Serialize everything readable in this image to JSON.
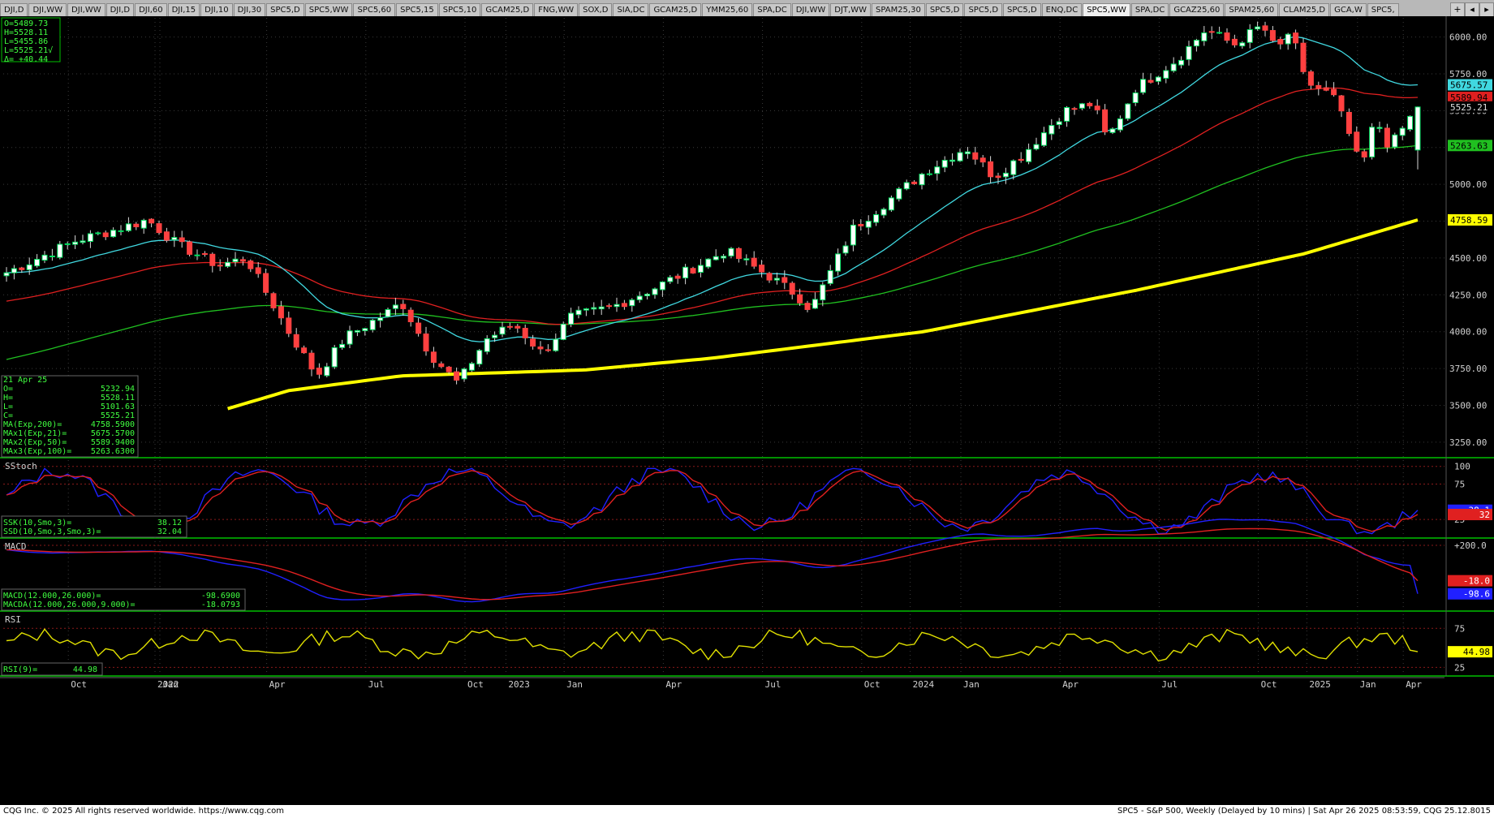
{
  "tabs": [
    "DJI,D",
    "DJI,WW",
    "DJI,WW",
    "DJI,D",
    "DJI,60",
    "DJI,15",
    "DJI,10",
    "DJI,30",
    "SPC5,D",
    "SPC5,WW",
    "SPC5,60",
    "SPC5,15",
    "SPC5,10",
    "GCAM25,D",
    "FNG,WW",
    "SOX,D",
    "SIA,DC",
    "GCAM25,D",
    "YMM25,60",
    "SPA,DC",
    "DJI,WW",
    "DJT,WW",
    "SPAM25,30",
    "SPC5,D",
    "SPC5,D",
    "SPC5,D",
    "ENQ,DC",
    "SPC5,WW",
    "SPA,DC",
    "GCAZ25,60",
    "SPAM25,60",
    "CLAM25,D",
    "GCA,W",
    "SPC5,"
  ],
  "active_tab": 27,
  "tab_controls": [
    "+",
    "◂",
    "▸"
  ],
  "footer": {
    "left": "CQG Inc. © 2025 All rights reserved worldwide. https://www.cqg.com",
    "right": "SPC5 - S&P 500, Weekly (Delayed by 10 mins) | Sat Apr 26 2025 08:53:59, CQG 25.12.8015"
  },
  "colors": {
    "background": "#000000",
    "grid": "#3a3a3a",
    "up_candle": "#00e060",
    "down_candle": "#ff4040",
    "wick": "#d8d8d8",
    "ma200": "#ffff00",
    "ma21": "#40d8e0",
    "ma50": "#e02020",
    "ma100": "#20c020",
    "ssk": "#2020ff",
    "ssd": "#e02020",
    "macd": "#2020ff",
    "macda": "#e02020",
    "rsi": "#e0e000",
    "panel_border": "#00c000",
    "text_green": "#40ff40"
  },
  "chart_data": [
    {
      "type": "candlestick",
      "title": "",
      "price_axis_ticks": [
        "6000.00",
        "5750.00",
        "5500.00",
        "5250.00",
        "5000.00",
        "4750.00",
        "4500.00",
        "4250.00",
        "4000.00",
        "3750.00",
        "3500.00",
        "3250.00"
      ],
      "ylim": [
        3150,
        6130
      ],
      "x_axis_labels": [
        "Oct",
        "2022",
        "Jan",
        "Apr",
        "Jul",
        "Oct",
        "2023",
        "Jan",
        "Apr",
        "Jul",
        "Oct",
        "2024",
        "Jan",
        "Apr",
        "Jul",
        "Oct",
        "2025",
        "Jan",
        "Apr"
      ],
      "price_tags": [
        {
          "value": 5675.57,
          "label": "5675.57",
          "color": "#40d8e0"
        },
        {
          "value": 5589.94,
          "label": "5589.94",
          "color": "#e02020"
        },
        {
          "value": 5525.21,
          "label": "5525.21",
          "color": "#000000"
        },
        {
          "value": 5263.63,
          "label": "5263.63",
          "color": "#20c020"
        },
        {
          "value": 4758.59,
          "label": "4758.59",
          "color": "#ffff00"
        }
      ],
      "ohlc_box": [
        "O=5489.73",
        "H=5528.11",
        "L=5455.86",
        "L=5525.21√",
        "Δ= +40.44"
      ],
      "data_window": [
        {
          "label": "21 Apr 25",
          "value": ""
        },
        {
          "label": "O=",
          "value": "5232.94"
        },
        {
          "label": "H=",
          "value": "5528.11"
        },
        {
          "label": "L=",
          "value": "5101.63"
        },
        {
          "label": "C=",
          "value": "5525.21"
        },
        {
          "label": "MA(Exp,200)=",
          "value": "4758.5900"
        },
        {
          "label": "MAx1(Exp,21)=",
          "value": "5675.5700"
        },
        {
          "label": "MAx2(Exp,50)=",
          "value": "5589.9400"
        },
        {
          "label": "MAx3(Exp,100)=",
          "value": "5263.6300"
        }
      ],
      "last_bar": {
        "date": "21 Apr 25",
        "open": 5232.94,
        "high": 5528.11,
        "low": 5101.63,
        "close": 5525.21
      },
      "moving_averages_last": {
        "ema200": 4758.59,
        "ema21": 5675.57,
        "ema50": 5589.94,
        "ema100": 5263.63
      },
      "ema200_anchors": [
        [
          15.6,
          3475
        ],
        [
          20,
          3600
        ],
        [
          28,
          3700
        ],
        [
          41,
          3740
        ],
        [
          50,
          3820
        ],
        [
          65,
          4000
        ],
        [
          80,
          4280
        ],
        [
          92,
          4530
        ],
        [
          100,
          4758.59
        ]
      ],
      "close_anchors": [
        [
          0,
          4400
        ],
        [
          5,
          4620
        ],
        [
          8,
          4700
        ],
        [
          10,
          4760
        ],
        [
          12,
          4600
        ],
        [
          15,
          4450
        ],
        [
          17,
          4500
        ],
        [
          20,
          4000
        ],
        [
          22,
          3700
        ],
        [
          24,
          3960
        ],
        [
          27,
          4130
        ],
        [
          28,
          4200
        ],
        [
          30,
          3850
        ],
        [
          32,
          3650
        ],
        [
          34,
          3950
        ],
        [
          36,
          4050
        ],
        [
          38,
          3850
        ],
        [
          40,
          4100
        ],
        [
          43,
          4170
        ],
        [
          46,
          4300
        ],
        [
          48,
          4400
        ],
        [
          51,
          4550
        ],
        [
          54,
          4380
        ],
        [
          56,
          4250
        ],
        [
          57,
          4150
        ],
        [
          60,
          4700
        ],
        [
          65,
          5080
        ],
        [
          68,
          5250
        ],
        [
          70,
          5050
        ],
        [
          72,
          5200
        ],
        [
          75,
          5500
        ],
        [
          77,
          5550
        ],
        [
          78,
          5300
        ],
        [
          80,
          5650
        ],
        [
          83,
          5850
        ],
        [
          85,
          6050
        ],
        [
          87,
          5950
        ],
        [
          89,
          6080
        ],
        [
          90,
          5900
        ],
        [
          91,
          6050
        ],
        [
          92,
          5700
        ],
        [
          94,
          5600
        ],
        [
          95,
          5380
        ],
        [
          96,
          5100
        ],
        [
          97,
          5450
        ],
        [
          98,
          5250
        ],
        [
          100,
          5525.21
        ]
      ]
    },
    {
      "type": "line",
      "title": "SStoch",
      "ylim": [
        0,
        110
      ],
      "axis_ticks": [
        "100",
        "75",
        "25"
      ],
      "tags": [
        {
          "label": "38.1",
          "value": 38.12,
          "color": "#2020ff"
        },
        {
          "label": "32",
          "value": 32.04,
          "color": "#e02020"
        }
      ],
      "info_lines": [
        {
          "label": "SSK(10,Smo,3)=",
          "value": "38.12"
        },
        {
          "label": "SSD(10,Smo,3,Smo,3)=",
          "value": "32.04"
        }
      ],
      "series": [
        {
          "key": "SSK",
          "last": 38.12
        },
        {
          "key": "SSD",
          "last": 32.04
        }
      ]
    },
    {
      "type": "line",
      "title": "MACD",
      "ylim": [
        -200,
        235
      ],
      "axis_ticks": [
        "+200.0"
      ],
      "tags": [
        {
          "label": "-18.0",
          "value": -18.08,
          "color": "#e02020"
        },
        {
          "label": "-98.6",
          "value": -98.69,
          "color": "#2020ff"
        }
      ],
      "info_lines": [
        {
          "label": "MACD(12.000,26.000)=",
          "value": "-98.6900"
        },
        {
          "label": "MACDA(12.000,26.000,9.000)=",
          "value": "-18.0793"
        }
      ],
      "series": [
        {
          "key": "MACD",
          "last": -98.69
        },
        {
          "key": "MACDA",
          "last": -18.08
        }
      ]
    },
    {
      "type": "line",
      "title": "RSI",
      "ylim": [
        15,
        95
      ],
      "axis_ticks": [
        "75",
        "25"
      ],
      "tags": [
        {
          "label": "44.98",
          "value": 44.98,
          "color": "#ffff00"
        }
      ],
      "info_lines": [
        {
          "label": "RSI(9)=",
          "value": "44.98"
        }
      ],
      "series": [
        {
          "key": "RSI",
          "last": 44.98
        }
      ]
    }
  ]
}
